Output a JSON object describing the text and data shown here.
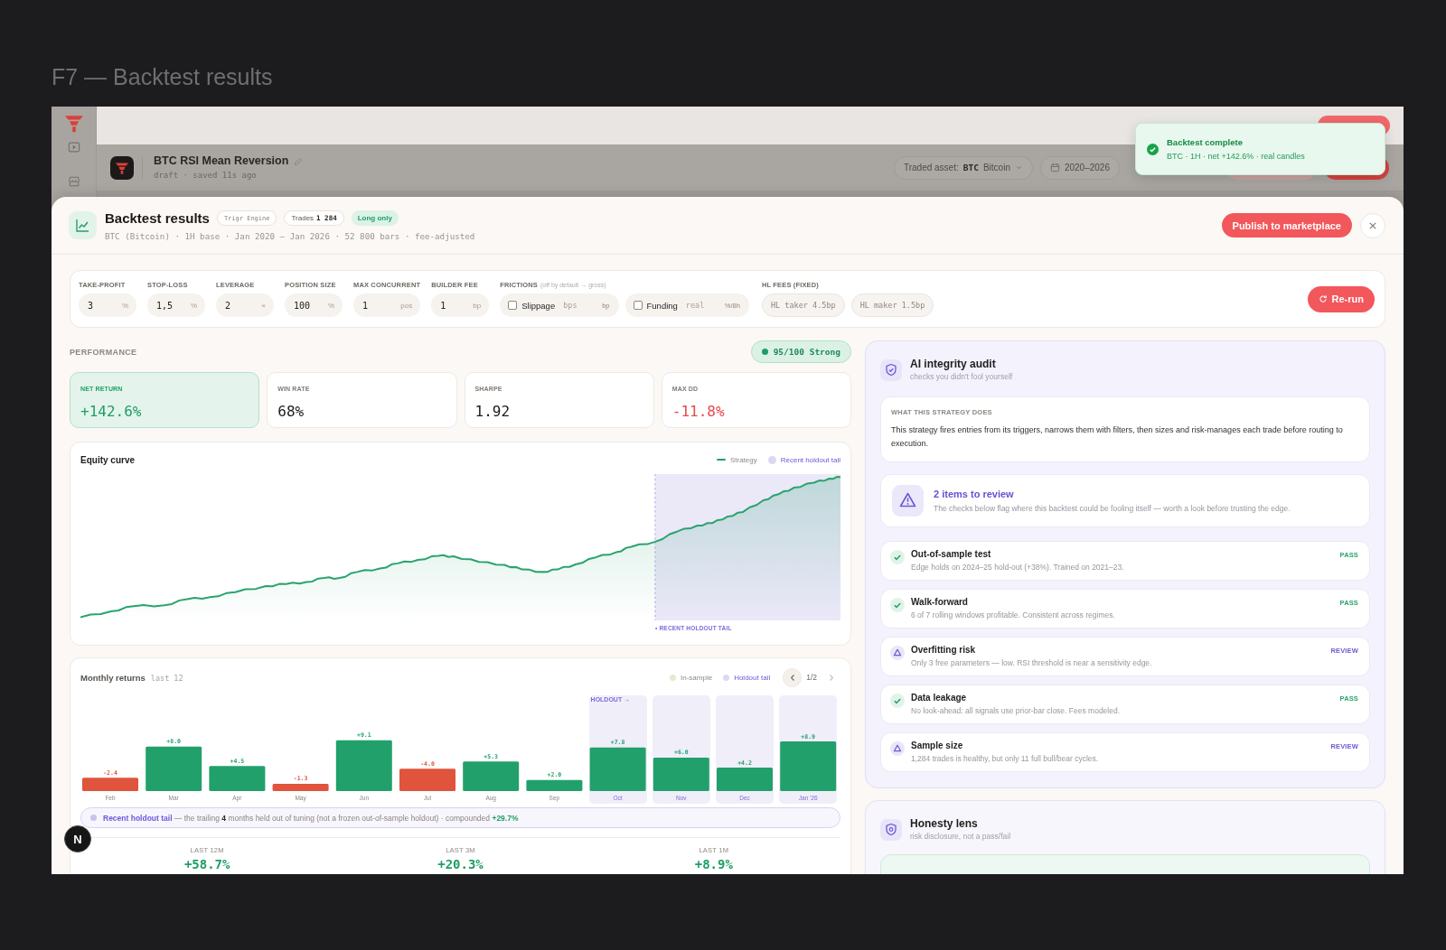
{
  "page": {
    "title": "F7 — Backtest results"
  },
  "app": {
    "strategy": {
      "name": "BTC RSI Mean Reversion",
      "meta": "draft · saved 11s ago"
    },
    "asset_picker": {
      "label": "Traded asset:",
      "symbol": "BTC",
      "name": "Bitcoin"
    },
    "date_range": "2020–2026"
  },
  "toast": {
    "title": "Backtest complete",
    "message": "BTC · 1H · net +142.6% · real candles"
  },
  "modal": {
    "title": "Backtest results",
    "badges": [
      {
        "kind": "engine",
        "text": "Trigr Engine"
      },
      {
        "kind": "count",
        "text": "Trades **1 284**"
      },
      {
        "kind": "mode",
        "text": "Long only"
      }
    ],
    "subtitle": "BTC (Bitcoin) · 1H base · Jan 2020 – Jan 2026 · 52 800 bars · fee-adjusted",
    "publish_button": "Publish to marketplace"
  },
  "params": {
    "fields": [
      {
        "label": "TAKE-PROFIT",
        "value": "3",
        "unit": "%"
      },
      {
        "label": "STOP-LOSS",
        "value": "1,5",
        "unit": "%"
      },
      {
        "label": "LEVERAGE",
        "value": "2",
        "unit": "×"
      },
      {
        "label": "POSITION SIZE",
        "value": "100",
        "unit": "%"
      },
      {
        "label": "MAX CONCURRENT",
        "value": "1",
        "unit": "pos"
      },
      {
        "label": "BUILDER FEE",
        "value": "1",
        "unit": "bp"
      }
    ],
    "frictions": {
      "label": "FRICTIONS",
      "note": "(off by default → gross)",
      "items": [
        {
          "label": "Slippage",
          "checked": false,
          "placeholder": "bps",
          "unit": "bp"
        },
        {
          "label": "Funding",
          "checked": false,
          "placeholder": "real",
          "unit": "%/8h"
        }
      ]
    },
    "fees": {
      "label": "HL FEES (FIXED)",
      "items": [
        "HL taker 4.5bp",
        "HL maker 1.5bp"
      ]
    },
    "rerun_button": "Re-run"
  },
  "performance": {
    "label": "PERFORMANCE",
    "score": "95/100 Strong",
    "kpis": [
      {
        "kind": "highlight",
        "label": "NET RETURN",
        "value": "+142.6%"
      },
      {
        "kind": "neutral",
        "label": "WIN RATE",
        "value": "68%"
      },
      {
        "kind": "neutral",
        "label": "SHARPE",
        "value": "1.92"
      },
      {
        "kind": "negative",
        "label": "MAX DD",
        "value": "-11.8%"
      }
    ]
  },
  "equity": {
    "title": "Equity curve",
    "legend": [
      {
        "kind": "line",
        "label": "Strategy"
      },
      {
        "kind": "band",
        "label": "Recent holdout tail"
      }
    ],
    "band_label": "• RECENT HOLDOUT TAIL"
  },
  "monthly": {
    "title": "Monthly returns",
    "tag": "last 12",
    "legend": [
      {
        "kind": "in-sample",
        "label": "In-sample"
      },
      {
        "kind": "holdout",
        "label": "Holdout tail"
      }
    ],
    "pager": {
      "text": "1/2",
      "prev_disabled": false,
      "next_disabled": true
    },
    "holdout_label": "HOLDOUT →",
    "chart_data": {
      "type": "other",
      "categories": [
        "Feb",
        "Mar",
        "Apr",
        "May",
        "Jun",
        "Jul",
        "Aug",
        "Sep",
        "Oct",
        "Nov",
        "Dec",
        "Jan '26"
      ],
      "values": [
        -2.4,
        8.0,
        4.5,
        -1.3,
        9.1,
        -4.0,
        5.3,
        2.0,
        7.8,
        6.0,
        4.2,
        8.9
      ],
      "colors": [
        "#e0533d",
        "#22a06b",
        "#22a06b",
        "#e0533d",
        "#22a06b",
        "#e0533d",
        "#22a06b",
        "#22a06b",
        "#22a06b",
        "#22a06b",
        "#22a06b",
        "#22a06b"
      ],
      "value_labels": [
        "-2.4",
        "+8.0",
        "+4.5",
        "-1.3",
        "+9.1",
        "-4.0",
        "+5.3",
        "+2.0",
        "+7.8",
        "+6.0",
        "+4.2",
        "+8.9"
      ]
    },
    "footnote": "**Recent holdout tail** — the trailing **4** months held out of tuning (not a frozen out-of-sample holdout) · compounded **+29.7%**",
    "summary": [
      {
        "label": "LAST 12M",
        "value": "+58.7%"
      },
      {
        "label": "LAST 3M",
        "value": "+20.3%"
      },
      {
        "label": "LAST 1M",
        "value": "+8.9%"
      }
    ]
  },
  "audit": {
    "title": "AI integrity audit",
    "subtitle": "checks you didn't fool yourself",
    "summary": {
      "label": "WHAT THIS STRATEGY DOES",
      "text": "This strategy fires entries from its triggers, narrows them with filters, then sizes and risk-manages each trade before routing to execution."
    },
    "review": {
      "title": "2 items to review",
      "text": "The checks below flag where this backtest could be fooling itself — worth a look before trusting the edge."
    },
    "checks": [
      {
        "kind": "pass",
        "title": "Out-of-sample test",
        "detail": "Edge holds on 2024–25 hold-out (+38%). Trained on 2021–23.",
        "status": "PASS"
      },
      {
        "kind": "pass",
        "title": "Walk-forward",
        "detail": "6 of 7 rolling windows profitable. Consistent across regimes.",
        "status": "PASS"
      },
      {
        "kind": "review",
        "title": "Overfitting risk",
        "detail": "Only 3 free parameters — low. RSI threshold is near a sensitivity edge.",
        "status": "REVIEW"
      },
      {
        "kind": "pass",
        "title": "Data leakage",
        "detail": "No look-ahead: all signals use prior-bar close. Fees modeled.",
        "status": "PASS"
      },
      {
        "kind": "review",
        "title": "Sample size",
        "detail": "1,284 trades is healthy, but only 11 full bull/bear cycles.",
        "status": "REVIEW"
      }
    ]
  },
  "honesty": {
    "title": "Honesty lens",
    "subtitle": "risk disclosure, not a pass/fail"
  },
  "dev_badge": "N"
}
